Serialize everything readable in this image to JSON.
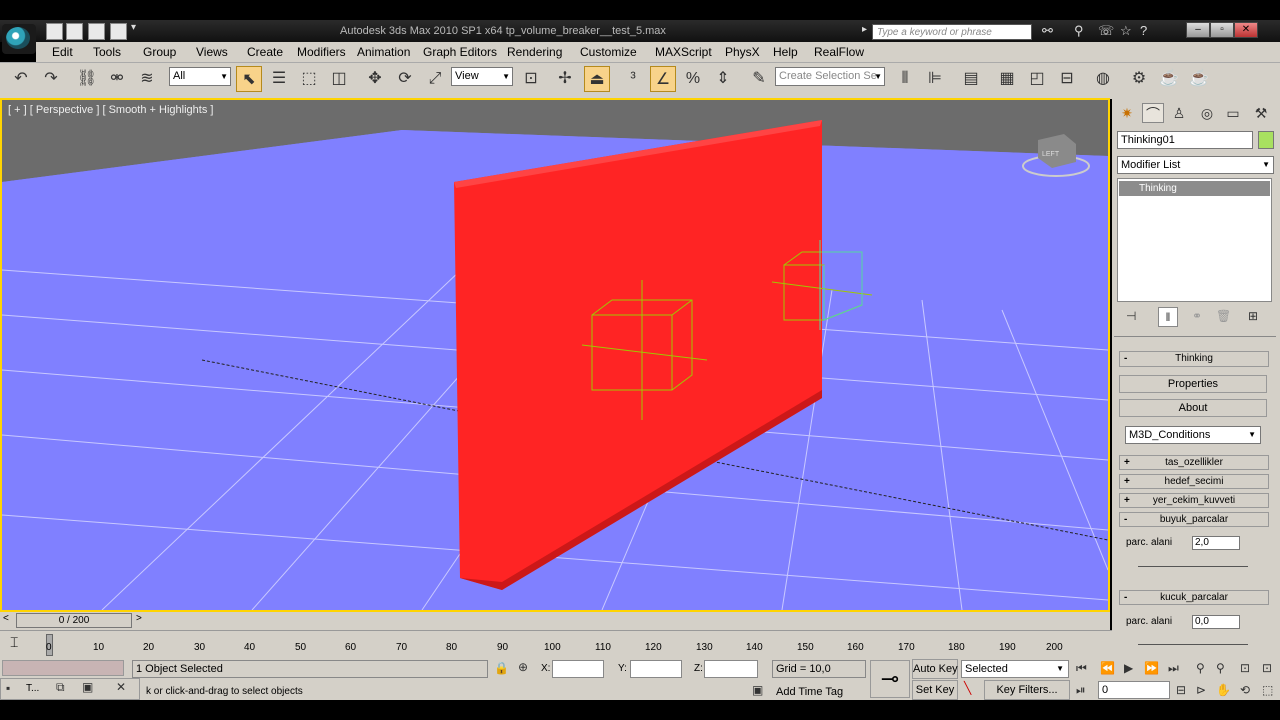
{
  "window": {
    "title": "Autodesk 3ds Max  2010 SP1 x64     tp_volume_breaker__test_5.max",
    "search_placeholder": "Type a keyword or phrase"
  },
  "menu": [
    "Edit",
    "Tools",
    "Group",
    "Views",
    "Create",
    "Modifiers",
    "Animation",
    "Graph Editors",
    "Rendering",
    "Customize",
    "MAXScript",
    "PhysX",
    "Help",
    "RealFlow"
  ],
  "toolbar": {
    "selection_filter": "All",
    "ref_coord": "View",
    "named_selection_placeholder": "Create Selection Se"
  },
  "viewport": {
    "label": "[ + ] [ Perspective ] [ Smooth + Highlights ]",
    "viewcube_text": "LEFT",
    "background": "#7e7eff",
    "object_color": "#ff2424"
  },
  "command_panel": {
    "object_name": "Thinking01",
    "object_color": "#a8e060",
    "modifier_list": "Modifier List",
    "stack_items": [
      "Thinking"
    ],
    "buttons": [
      "Thinking",
      "Properties",
      "About"
    ],
    "conditions_dropdown": "M3D_Conditions",
    "rollouts": [
      {
        "sign": "+",
        "label": "tas_ozellikler"
      },
      {
        "sign": "+",
        "label": "hedef_secimi"
      },
      {
        "sign": "+",
        "label": "yer_cekim_kuvveti"
      },
      {
        "sign": "-",
        "label": "buyuk_parcalar"
      },
      {
        "sign": "-",
        "label": "kucuk_parcalar"
      }
    ],
    "buyuk_label": "parc. alani",
    "buyuk_value": "2,0",
    "kucuk_label": "parc. alani",
    "kucuk_value": "0,0",
    "thinking_sign": "-"
  },
  "timeline": {
    "frame_display": "0 / 200",
    "ticks": [
      "0",
      "10",
      "20",
      "30",
      "40",
      "50",
      "60",
      "70",
      "80",
      "90",
      "100",
      "110",
      "120",
      "130",
      "140",
      "150",
      "160",
      "170",
      "180",
      "190",
      "200"
    ]
  },
  "status": {
    "selection": "1 Object Selected",
    "prompt": "k or click-and-drag to select objects",
    "x_label": "X:",
    "y_label": "Y:",
    "z_label": "Z:",
    "grid": "Grid = 10,0",
    "add_time_tag": "Add Time Tag",
    "auto_key": "Auto Key",
    "set_key": "Set Key",
    "key_mode": "Selected",
    "key_filters": "Key Filters...",
    "current_frame": "0",
    "taskbar_label": "T..."
  }
}
